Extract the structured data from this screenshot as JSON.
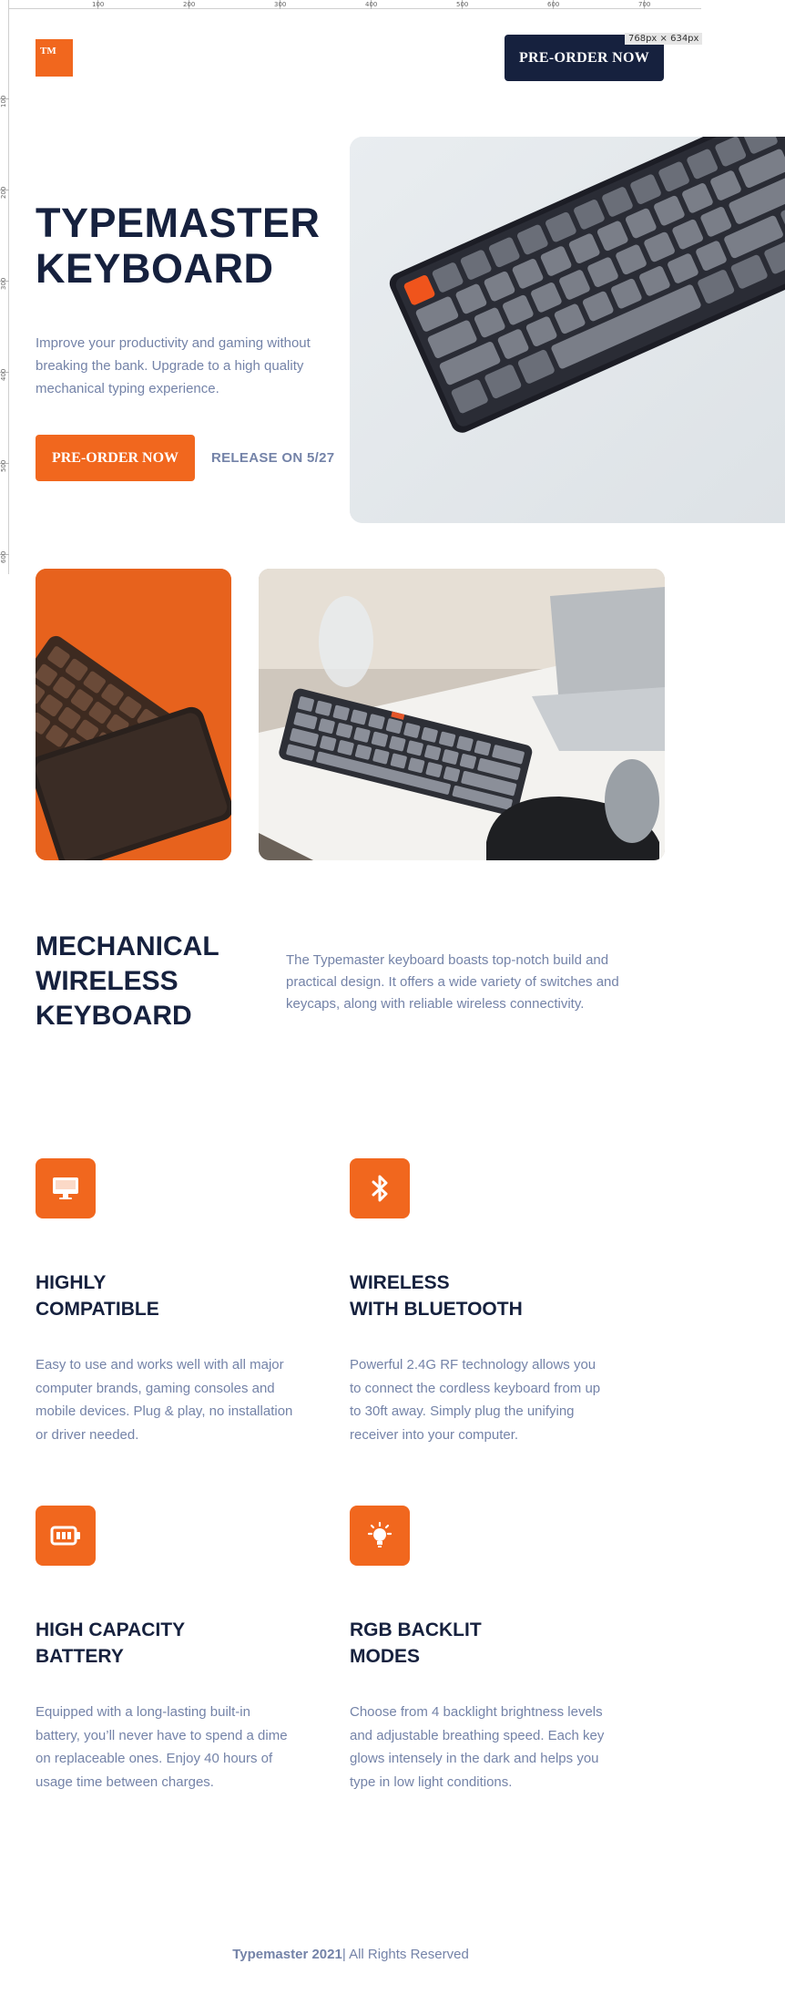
{
  "devtools": {
    "ruler_marks": [
      "100",
      "200",
      "300",
      "400",
      "500",
      "600",
      "700"
    ],
    "viewport_badge": "768px × 634px"
  },
  "header": {
    "logo_text": "TM",
    "cta_label": "PRE-ORDER NOW"
  },
  "hero": {
    "title_line1": "TYPEMASTER",
    "title_line2": "KEYBOARD",
    "description": "Improve your productivity and gaming without breaking the bank. Upgrade to a high quality mechanical typing experience.",
    "cta_label": "PRE-ORDER NOW",
    "release_text": "RELEASE ON 5/27"
  },
  "intro": {
    "title_line1": "MECHANICAL",
    "title_line2": "WIRELESS",
    "title_line3": "KEYBOARD",
    "description": "The Typemaster keyboard boasts top-notch build and practical design. It offers a wide variety of switches and keycaps, along with reliable wireless connectivity."
  },
  "features": [
    {
      "icon": "monitor-icon",
      "title_line1": "HIGHLY",
      "title_line2": "COMPATIBLE",
      "description": "Easy to use and works well with all major computer brands, gaming consoles and mobile devices. Plug & play, no installation or driver needed."
    },
    {
      "icon": "bluetooth-icon",
      "title_line1": "WIRELESS",
      "title_line2": "WITH BLUETOOTH",
      "description": "Powerful 2.4G RF technology allows you to connect the cordless keyboard from up to 30ft away. Simply plug the unifying receiver into your computer."
    },
    {
      "icon": "battery-icon",
      "title_line1": "HIGH CAPACITY",
      "title_line2": "BATTERY",
      "description": "Equipped with a long-lasting built-in battery, you’ll never have to spend a dime on replaceable ones.  Enjoy 40 hours of usage time between charges."
    },
    {
      "icon": "lightbulb-icon",
      "title_line1": "RGB BACKLIT",
      "title_line2": "MODES",
      "description": "Choose from 4 backlight brightness levels and adjustable breathing speed. Each key glows intensely in the dark and helps you type in low light conditions."
    }
  ],
  "footer": {
    "brand": "Typemaster 2021",
    "rights": "| All Rights Reserved"
  },
  "colors": {
    "accent": "#f1671e",
    "navy": "#16213e",
    "muted": "#7483a8"
  }
}
